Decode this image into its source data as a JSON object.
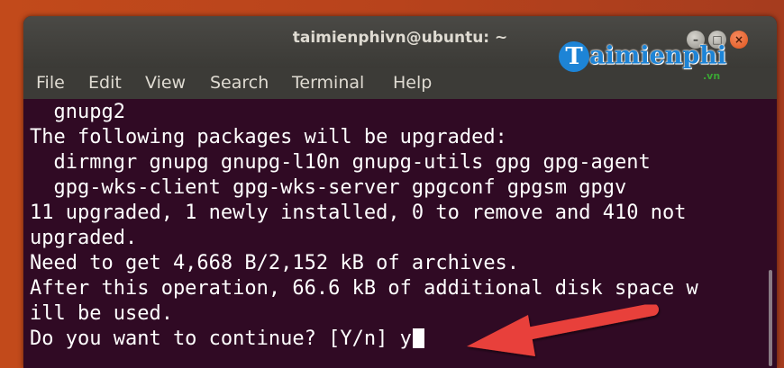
{
  "window": {
    "title": "taimienphivn@ubuntu: ~",
    "buttons": {
      "minimize": "–",
      "maximize": "□",
      "close": "×"
    }
  },
  "menubar": {
    "items": [
      "File",
      "Edit",
      "View",
      "Search",
      "Terminal",
      "Help"
    ]
  },
  "watermark": {
    "initial": "T",
    "text": "aimienphi",
    "suffix": ".vn"
  },
  "terminal": {
    "lines": [
      "  gnupg2",
      "The following packages will be upgraded:",
      "  dirmngr gnupg gnupg-l10n gnupg-utils gpg gpg-agent",
      "  gpg-wks-client gpg-wks-server gpgconf gpgsm gpgv",
      "11 upgraded, 1 newly installed, 0 to remove and 410 not",
      "upgraded.",
      "Need to get 4,668 B/2,152 kB of archives.",
      "After this operation, 66.6 kB of additional disk space w",
      "ill be used."
    ],
    "prompt": "Do you want to continue? [Y/n] ",
    "input": "y"
  },
  "colors": {
    "terminal_bg": "#300a24",
    "titlebar_bg": "#3c3b37",
    "close_button": "#e0541c",
    "annotation_arrow": "#e8403a"
  },
  "icons": [
    "minimize-icon",
    "maximize-icon",
    "close-icon",
    "annotation-arrow-icon"
  ]
}
